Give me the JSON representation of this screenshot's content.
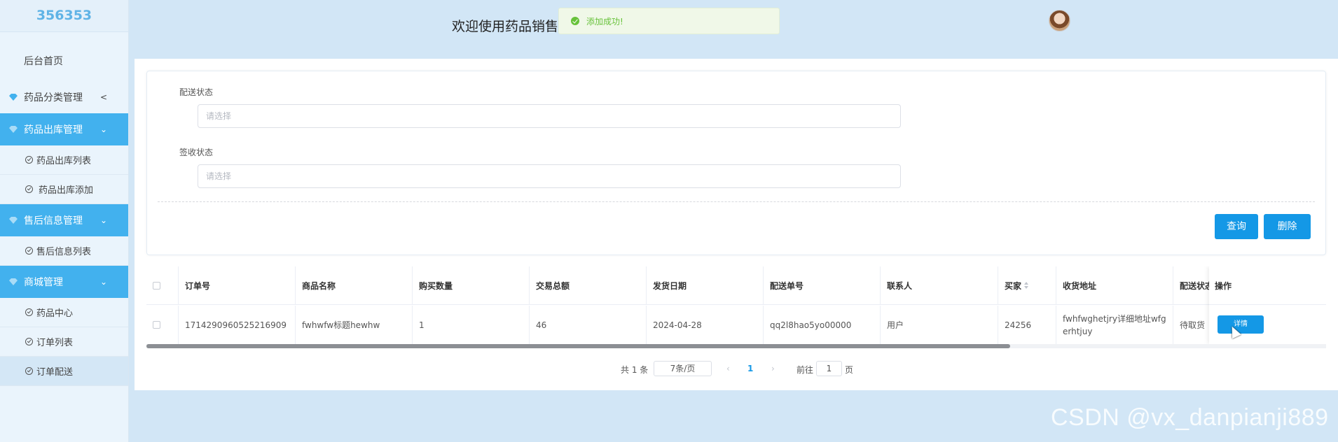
{
  "sidebar": {
    "brand": "356353",
    "home": "后台首页",
    "groups": [
      {
        "label": "药品分类管理",
        "chevron": "<"
      },
      {
        "label": "药品出库管理",
        "chevron": "⌄",
        "items": [
          "药品出库列表",
          "药品出库添加"
        ]
      },
      {
        "label": "售后信息管理",
        "chevron": "⌄",
        "items": [
          "售后信息列表"
        ]
      },
      {
        "label": "商城管理",
        "chevron": "⌄",
        "items": [
          "药品中心",
          "订单列表",
          "订单配送"
        ]
      }
    ]
  },
  "header": {
    "welcome": "欢迎使用药品销售",
    "toast": "添加成功!"
  },
  "form": {
    "delivery_label": "配送状态",
    "delivery_placeholder": "请选择",
    "receipt_label": "签收状态",
    "receipt_placeholder": "请选择",
    "query_button": "查询",
    "delete_button": "删除"
  },
  "table": {
    "headers": [
      "订单号",
      "商品名称",
      "购买数量",
      "交易总额",
      "发货日期",
      "配送单号",
      "联系人",
      "买家",
      "收货地址",
      "配送状态",
      "操作"
    ],
    "row": {
      "order_no": "1714290960525216909",
      "product": "fwhwfw标题hewhw",
      "qty": "1",
      "total": "46",
      "ship_date": "2024-04-28",
      "tracking_no": "qq2l8hao5yo00000",
      "contact": "用户",
      "buyer": "24256",
      "address": "fwhfwghetjry详细地址wfgerhtjuy",
      "status": "待取货",
      "detail_button": "详情"
    }
  },
  "pagination": {
    "total": "共 1 条",
    "page_size": "7条/页",
    "current_page": "1",
    "goto_prefix": "前往",
    "goto_value": "1",
    "goto_suffix": "页"
  },
  "watermark": "CSDN @vx_danpianji889",
  "colors": {
    "accent": "#42b1ee",
    "button": "#1498e6",
    "success": "#67c23a",
    "background": "#d2e6f6"
  }
}
